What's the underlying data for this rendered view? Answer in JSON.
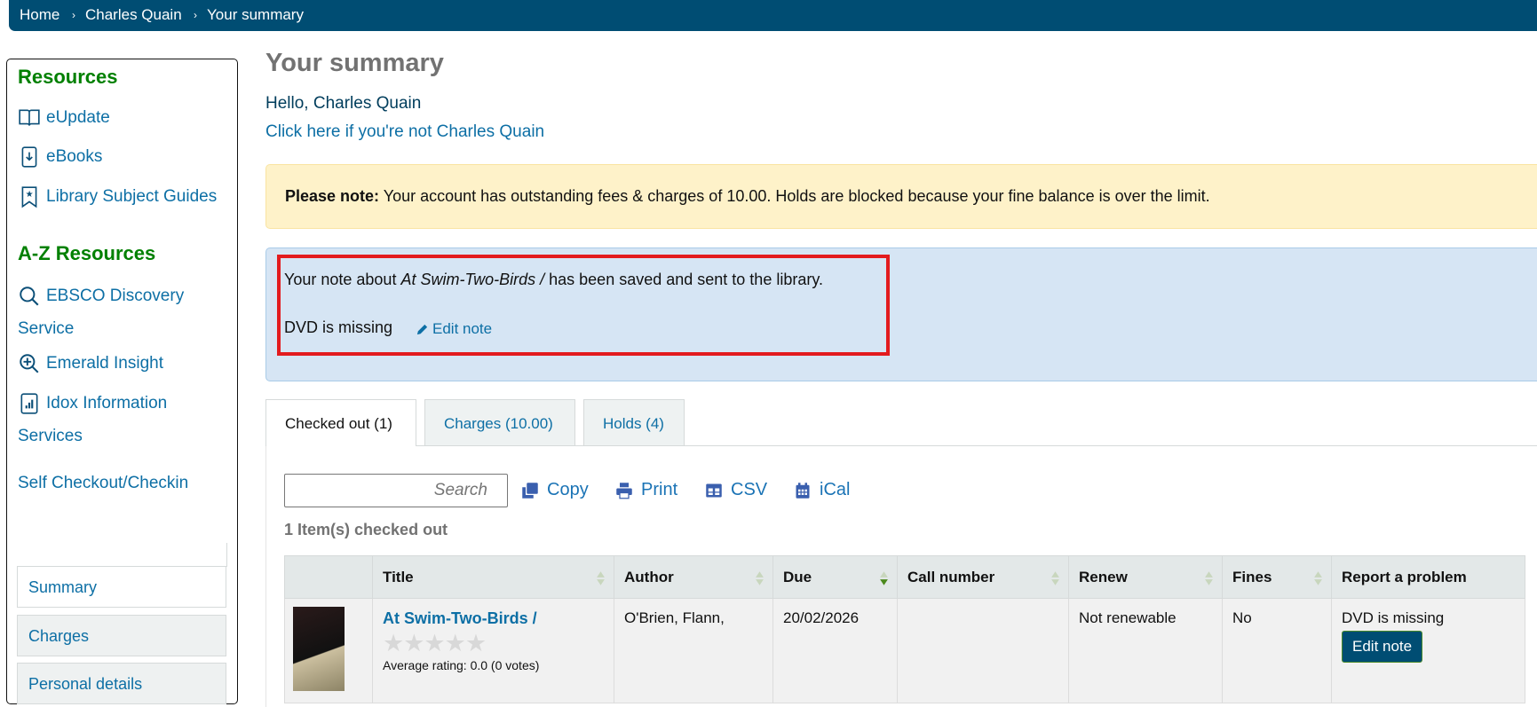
{
  "breadcrumb": [
    "Home",
    "Charles Quain",
    "Your summary"
  ],
  "sidebar": {
    "resources_heading": "Resources",
    "resources": [
      {
        "label": "eUpdate",
        "icon": "book-open-icon"
      },
      {
        "label": "eBooks",
        "icon": "download-book-icon"
      },
      {
        "label": "Library Subject Guides",
        "icon": "bookmark-star-icon"
      }
    ],
    "az_heading": "A-Z Resources",
    "az": [
      {
        "label_1": "EBSCO Discovery",
        "label_2": "Service",
        "icon": "search-icon"
      },
      {
        "label": "Emerald Insight",
        "icon": "zoom-in-icon"
      },
      {
        "label_1": "Idox Information",
        "label_2": "Services",
        "icon": "chart-doc-icon"
      },
      {
        "label": "Self Checkout/Checkin"
      }
    ],
    "nav": [
      "Summary",
      "Charges",
      "Personal details"
    ]
  },
  "main": {
    "title": "Your summary",
    "hello": "Hello, Charles Quain",
    "not_me": "Click here if you're not Charles Quain",
    "warning_bold": "Please note:",
    "warning_text": " Your account has outstanding fees & charges of 10.00. Holds are blocked because your fine balance is over the limit.",
    "note_pre": "Your note about ",
    "note_title": "At Swim-Two-Birds /",
    "note_post": " has been saved and sent to the library.",
    "note_text": "DVD is missing",
    "edit_note_link": "Edit note",
    "tabs": [
      "Checked out (1)",
      "Charges (10.00)",
      "Holds (4)"
    ],
    "search_placeholder": "Search",
    "tools": [
      "Copy",
      "Print",
      "CSV",
      "iCal"
    ],
    "count": "1 Item(s) checked out",
    "table": {
      "headers": [
        "Title",
        "Author",
        "Due",
        "Call number",
        "Renew",
        "Fines",
        "Report a problem"
      ],
      "row": {
        "title": "At Swim-Two-Birds /",
        "rating": "Average rating: 0.0 (0 votes)",
        "author": "O'Brien, Flann,",
        "due": "20/02/2026",
        "call_number": "",
        "renew": "Not renewable",
        "fines": "No",
        "problem": "DVD is missing",
        "edit_button": "Edit note"
      }
    }
  },
  "colors": {
    "brand": "#004d73",
    "heading_green": "#008000",
    "link": "#0d6fa5",
    "highlight": "#e31b1e"
  }
}
